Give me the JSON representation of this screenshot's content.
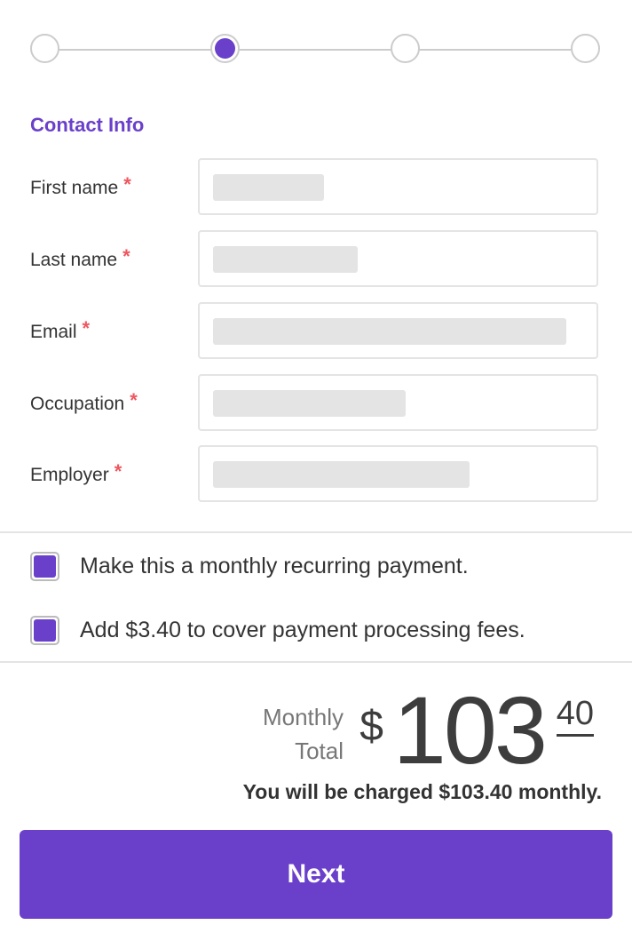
{
  "stepper": {
    "total_steps": 4,
    "current_step": 2
  },
  "section": {
    "title": "Contact Info"
  },
  "form": {
    "required_marker": "*",
    "fields": [
      {
        "label": "First name",
        "value": "",
        "redacted": true
      },
      {
        "label": "Last name",
        "value": "",
        "redacted": true
      },
      {
        "label": "Email",
        "value": "",
        "redacted": true
      },
      {
        "label": "Occupation",
        "value": "",
        "redacted": true
      },
      {
        "label": "Employer",
        "value": "",
        "redacted": true
      }
    ]
  },
  "options": [
    {
      "label": "Make this a monthly recurring payment.",
      "checked": true
    },
    {
      "label": "Add $3.40 to cover payment processing fees.",
      "checked": true
    }
  ],
  "total": {
    "label_line1": "Monthly",
    "label_line2": "Total",
    "currency": "$",
    "dollars": "103",
    "cents": "40",
    "note": "You will be charged $103.40 monthly."
  },
  "actions": {
    "next_label": "Next"
  },
  "colors": {
    "accent": "#6a40cb",
    "required": "#f0565f",
    "border": "#e4e4e4"
  }
}
